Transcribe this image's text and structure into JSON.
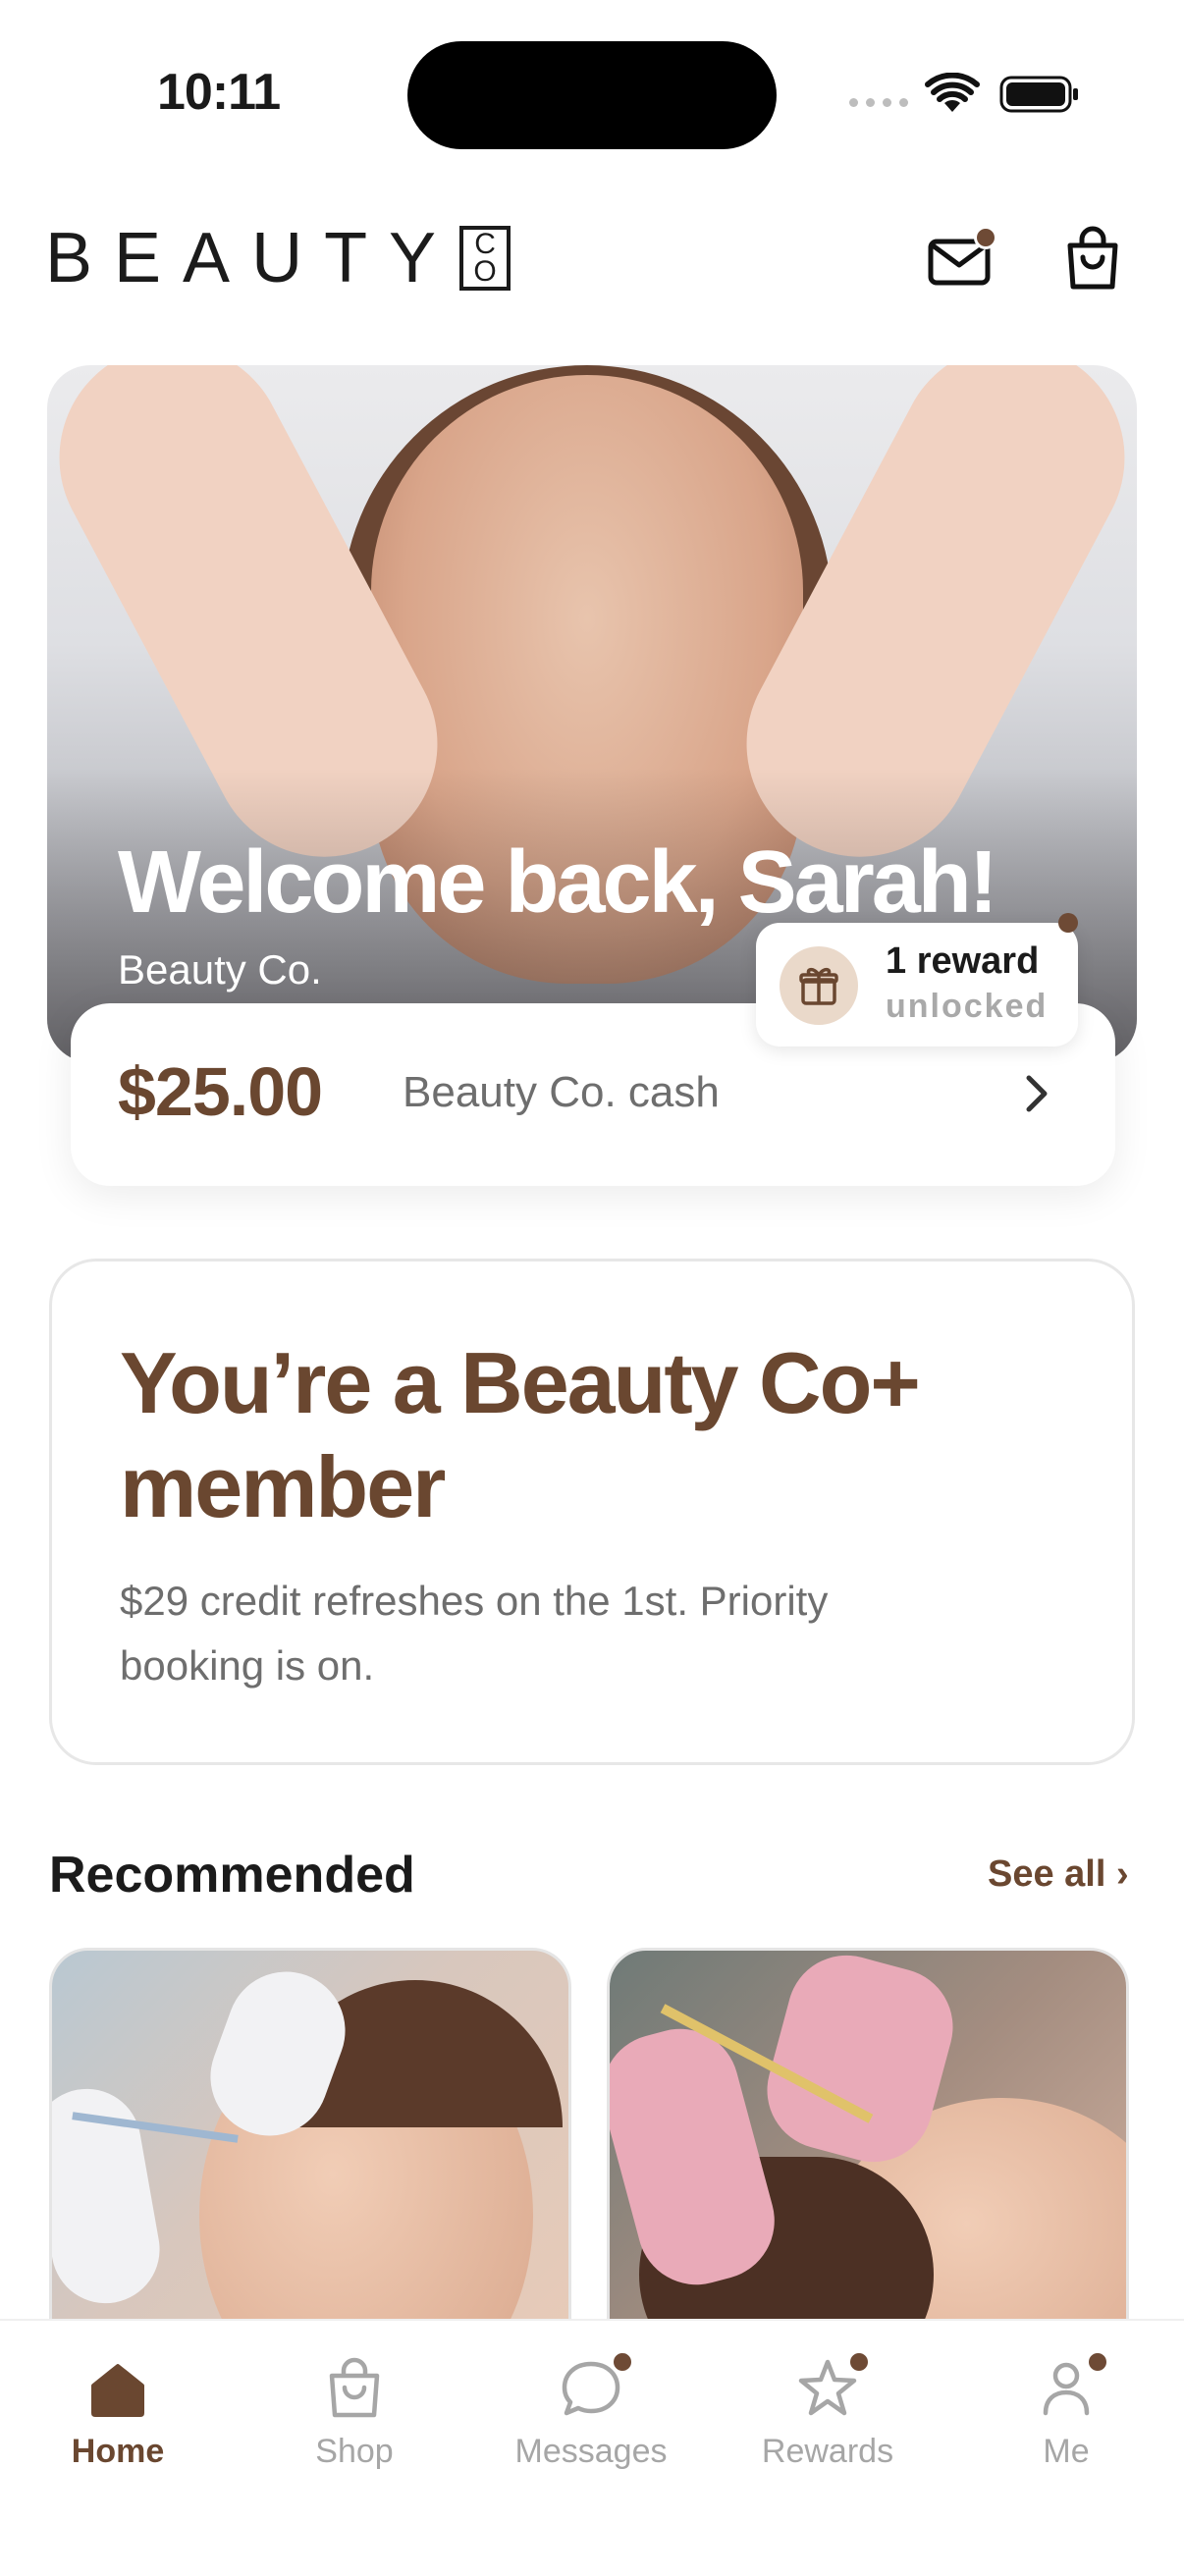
{
  "status_bar": {
    "time": "10:11"
  },
  "header": {
    "logo_text": "BEAUTY",
    "logo_box_top": "C",
    "logo_box_bottom": "O",
    "icons": [
      "mail-icon",
      "shopping-bag-icon"
    ]
  },
  "hero": {
    "welcome": "Welcome back, Sarah!",
    "subtitle": "Beauty Co."
  },
  "reward_chip": {
    "title": "1 reward",
    "subtitle": "unlocked",
    "icon": "gift-icon"
  },
  "cash": {
    "amount": "$25.00",
    "label": "Beauty Co. cash"
  },
  "membership": {
    "title": "You’re a Beauty Co+ member",
    "description": "$29 credit refreshes on the 1st. Priority booking is on."
  },
  "recommended": {
    "title": "Recommended",
    "see_all": "See all ›"
  },
  "tabs": [
    {
      "label": "Home",
      "icon": "home-icon",
      "active": true
    },
    {
      "label": "Shop",
      "icon": "shopping-bag-icon",
      "active": false
    },
    {
      "label": "Messages",
      "icon": "chat-bubble-icon",
      "active": false
    },
    {
      "label": "Rewards",
      "icon": "star-icon",
      "active": false
    },
    {
      "label": "Me",
      "icon": "person-icon",
      "active": false
    }
  ],
  "colors": {
    "accent": "#6a4730",
    "notification_dot": "#6e4a35",
    "muted_text": "#6e6e6e",
    "inactive_tab": "#a6a6a6"
  }
}
